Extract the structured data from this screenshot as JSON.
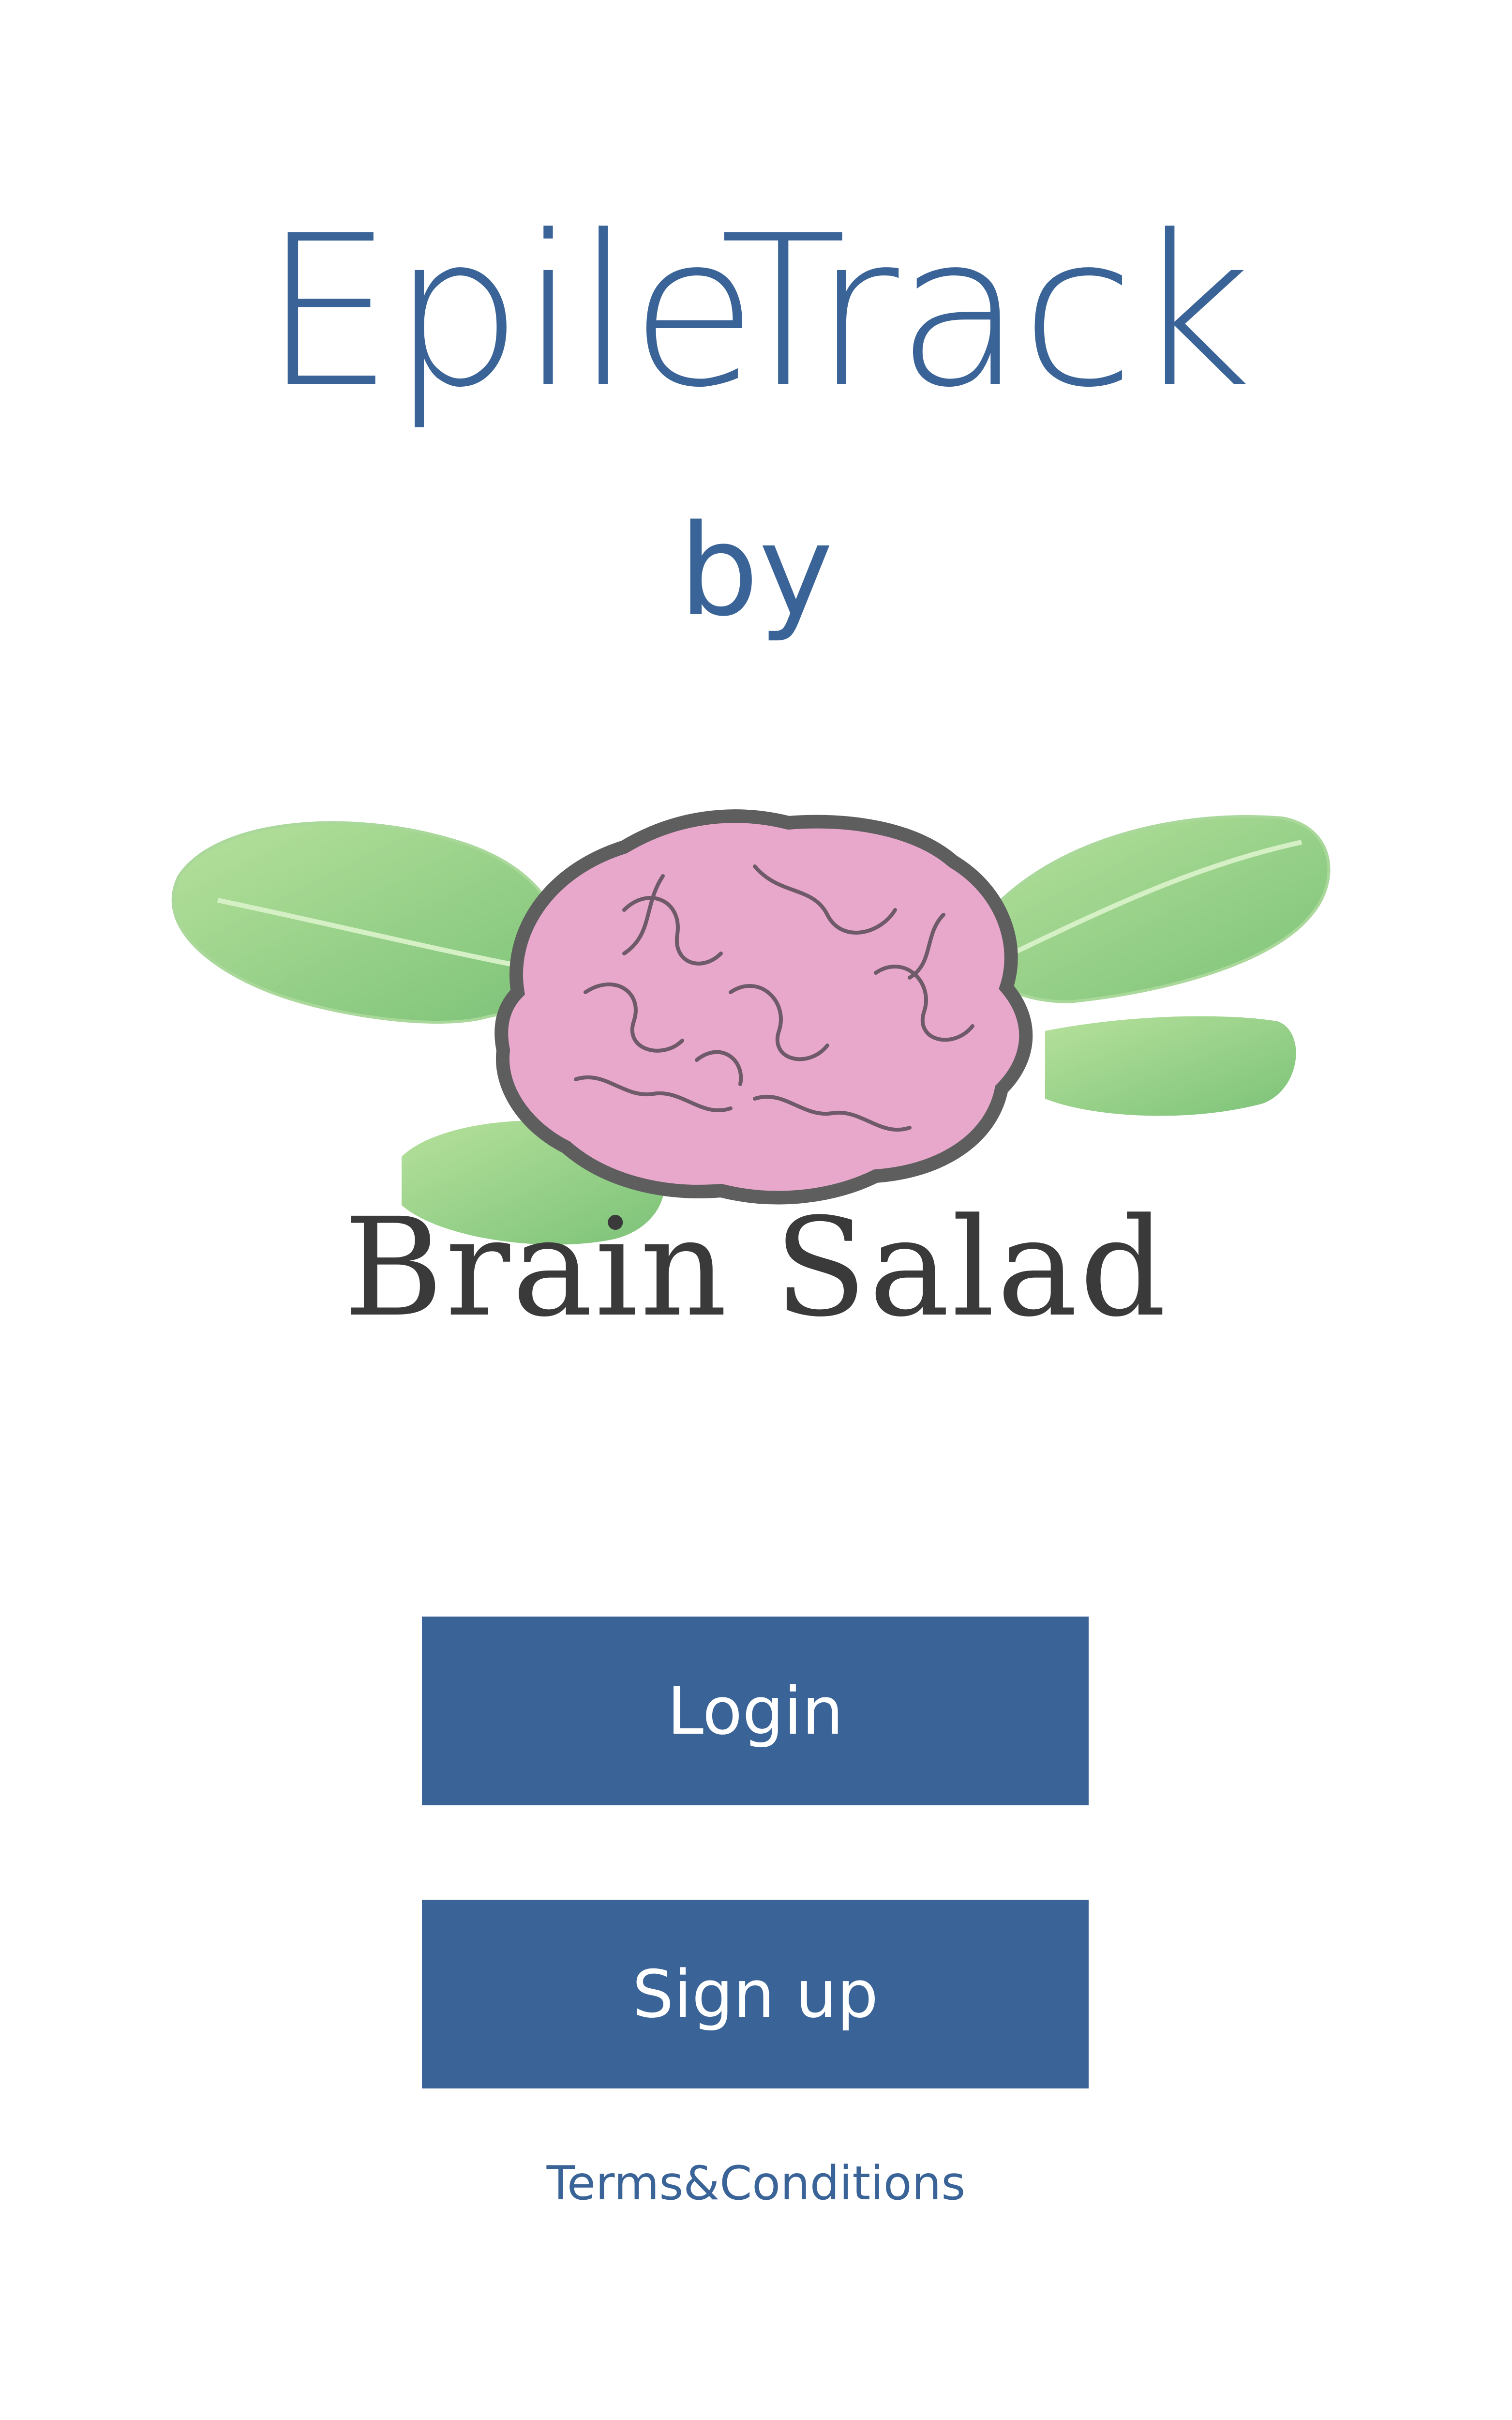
{
  "app": {
    "title": "EpileTrack",
    "by_label": "by"
  },
  "logo": {
    "name": "Brain Salad",
    "icon": "brain-salad-logo",
    "colors": {
      "leaf": "#8cc97a",
      "brain": "#e8a8cc",
      "outline": "#5e5e5e"
    }
  },
  "actions": {
    "login_label": "Login",
    "signup_label": "Sign up",
    "terms_label": "Terms&Conditions"
  },
  "theme": {
    "primary": "#3a6497",
    "background": "#ffffff"
  }
}
